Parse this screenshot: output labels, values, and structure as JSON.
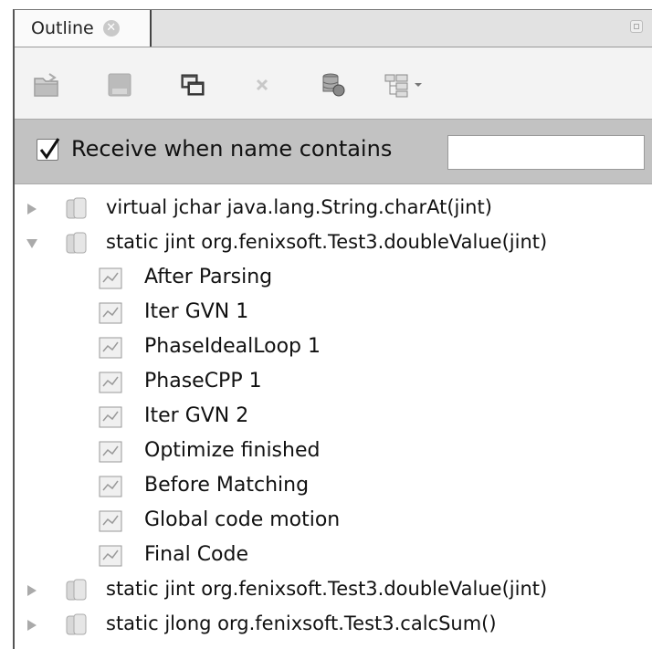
{
  "tab": {
    "label": "Outline",
    "close_icon": "close-circle-icon"
  },
  "toolbar": {
    "buttons": [
      {
        "name": "open-folder-icon"
      },
      {
        "name": "save-disabled-icon"
      },
      {
        "name": "copy-windows-icon"
      },
      {
        "name": "remove-icon"
      },
      {
        "name": "database-icon"
      },
      {
        "name": "hierarchy-dropdown-icon"
      }
    ]
  },
  "filter": {
    "checked": true,
    "label": "Receive when name contains",
    "value": ""
  },
  "tree": {
    "groups": [
      {
        "label": "virtual jchar java.lang.String.charAt(jint)",
        "expanded": false
      },
      {
        "label": "static jint org.fenixsoft.Test3.doubleValue(jint)",
        "expanded": true,
        "children": [
          "After Parsing",
          "Iter GVN 1",
          "PhaseIdealLoop 1",
          "PhaseCPP 1",
          "Iter GVN 2",
          "Optimize finished",
          "Before Matching",
          "Global code motion",
          "Final Code"
        ]
      },
      {
        "label": "static jint org.fenixsoft.Test3.doubleValue(jint)",
        "expanded": false
      },
      {
        "label": "static jlong org.fenixsoft.Test3.calcSum()",
        "expanded": false
      }
    ]
  }
}
